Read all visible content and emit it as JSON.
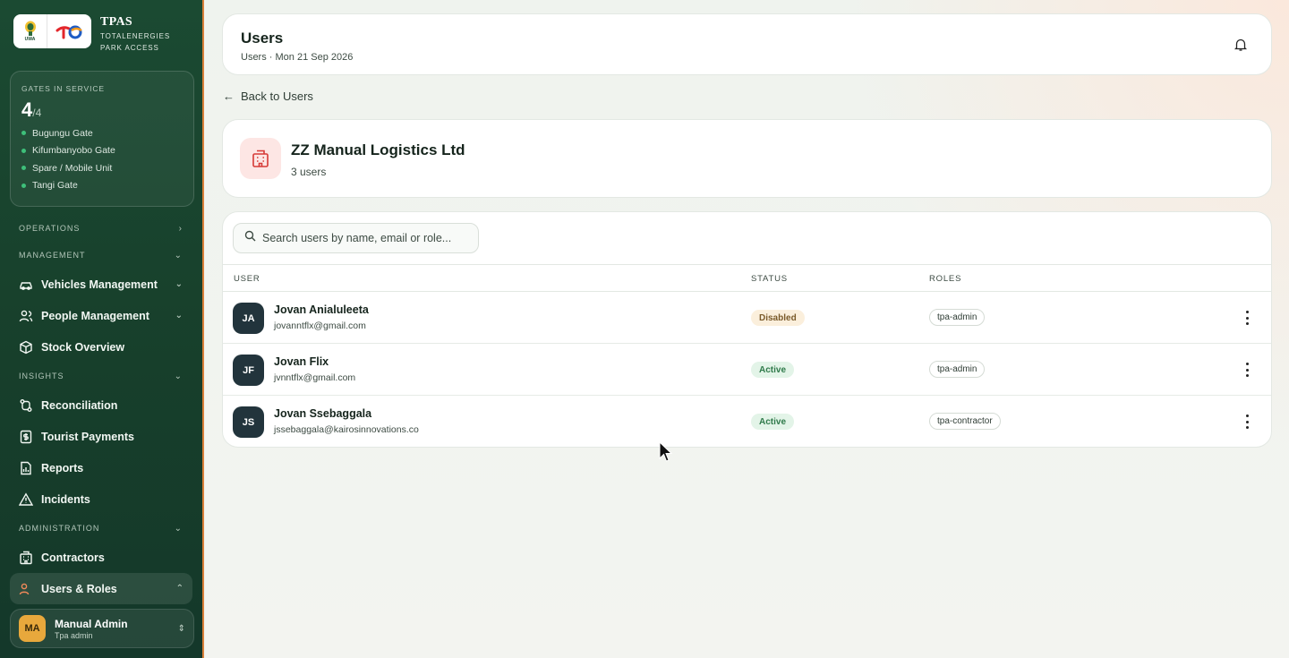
{
  "brand": {
    "title": "TPAS",
    "subtitle_line1": "TOTALENERGIES",
    "subtitle_line2": "PARK ACCESS",
    "uwa_text": "UWA"
  },
  "gates": {
    "label": "GATES IN SERVICE",
    "active": "4",
    "total": "/4",
    "list": [
      "Bugungu Gate",
      "Kifumbanyobo Gate",
      "Spare / Mobile Unit",
      "Tangi Gate"
    ],
    "status_color": "#3ec07a"
  },
  "nav": {
    "operations": "OPERATIONS",
    "management": "MANAGEMENT",
    "vehicles": "Vehicles Management",
    "people": "People Management",
    "stock": "Stock Overview",
    "insights": "INSIGHTS",
    "reconciliation": "Reconciliation",
    "tourist_payments": "Tourist Payments",
    "reports": "Reports",
    "incidents": "Incidents",
    "administration": "ADMINISTRATION",
    "contractors": "Contractors",
    "users_roles": "Users & Roles"
  },
  "current_user": {
    "initials": "MA",
    "name": "Manual Admin",
    "role": "Tpa admin"
  },
  "header": {
    "title": "Users",
    "subtitle": "Users · Mon 21 Sep 2026"
  },
  "back_link": "Back to Users",
  "org": {
    "name": "ZZ Manual Logistics Ltd",
    "count": "3 users",
    "accent": "#d63a36"
  },
  "search": {
    "placeholder": "Search users by name, email or role..."
  },
  "table": {
    "headers": {
      "user": "USER",
      "status": "STATUS",
      "roles": "ROLES"
    },
    "rows": [
      {
        "initials": "JA",
        "name": "Jovan Anialuleeta",
        "email": "jovanntflx@gmail.com",
        "status": "Disabled",
        "role": "tpa-admin"
      },
      {
        "initials": "JF",
        "name": "Jovan Flix",
        "email": "jvnntflx@gmail.com",
        "status": "Active",
        "role": "tpa-admin"
      },
      {
        "initials": "JS",
        "name": "Jovan Ssebaggala",
        "email": "jssebaggala@kairosinnovations.co",
        "status": "Active",
        "role": "tpa-contractor"
      }
    ]
  },
  "colors": {
    "sidebar": "#1b4a32",
    "accent_border": "#d9803a",
    "badge_active": "#2f7a4a",
    "badge_disabled": "#7a5a2a"
  }
}
